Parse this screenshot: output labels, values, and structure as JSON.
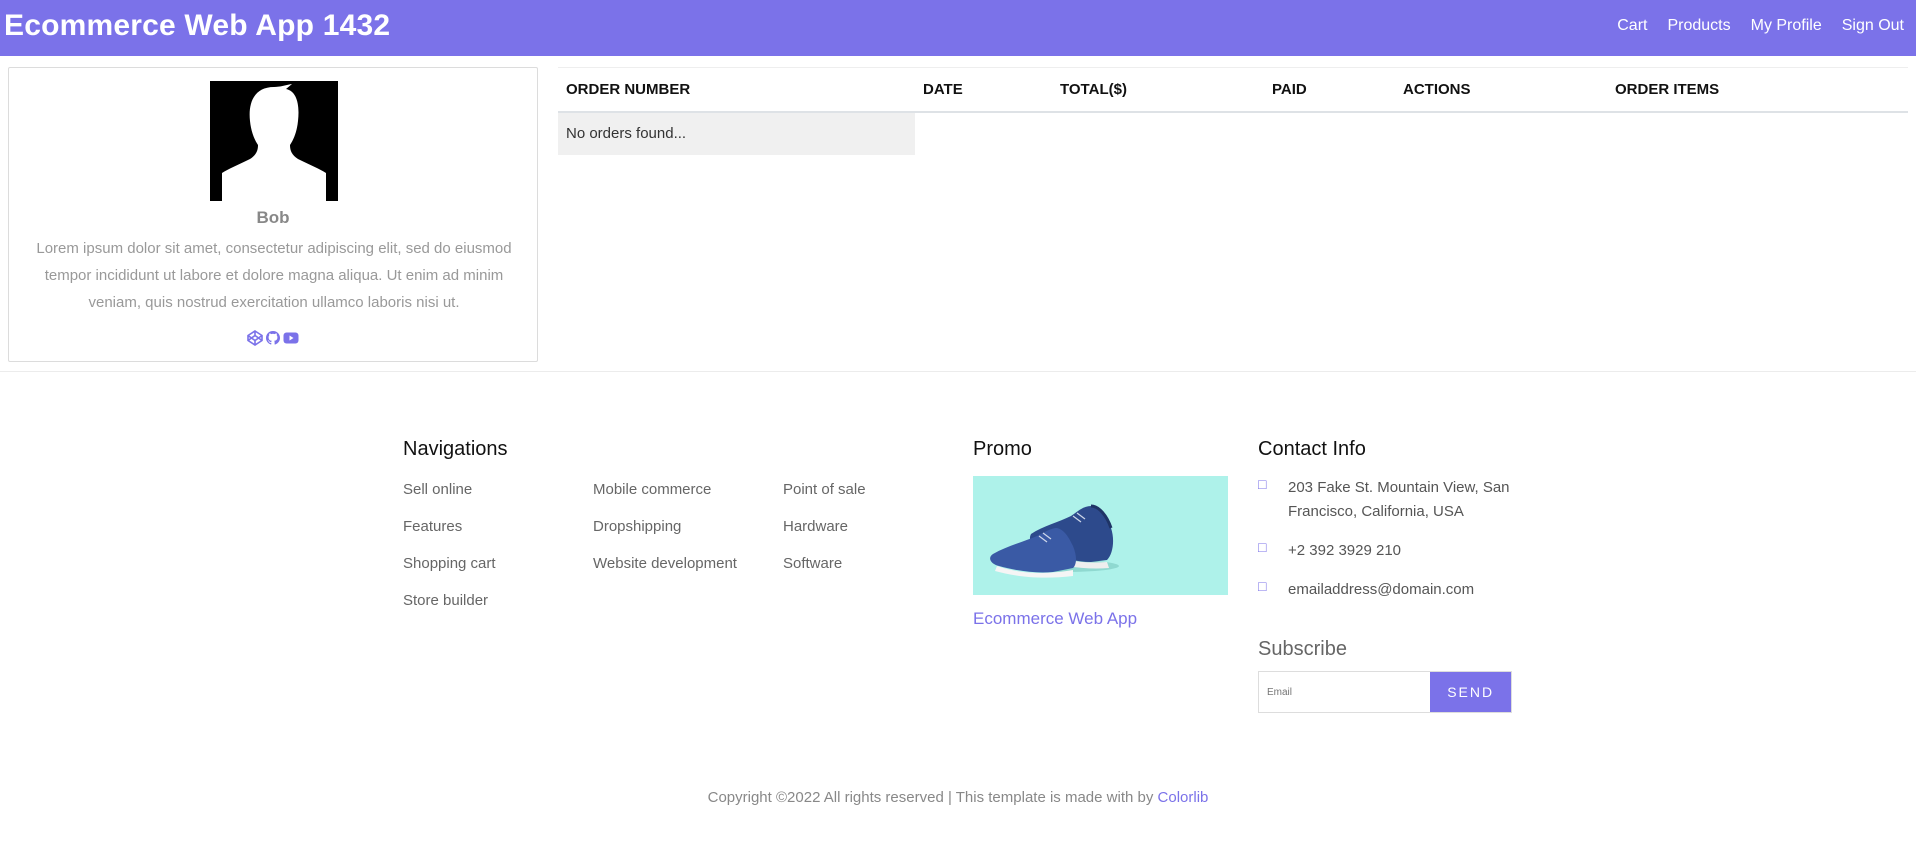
{
  "header": {
    "brand": "Ecommerce Web App 1432",
    "nav": [
      "Cart",
      "Products",
      "My Profile",
      "Sign Out"
    ]
  },
  "profile": {
    "name": "Bob",
    "bio": "Lorem ipsum dolor sit amet, consectetur adipiscing elit, sed do eiusmod tempor incididunt ut labore et dolore magna aliqua. Ut enim ad minim veniam, quis nostrud exercitation ullamco laboris nisi ut.",
    "socials": [
      "codepen-icon",
      "github-icon",
      "youtube-icon"
    ]
  },
  "orders": {
    "columns": [
      "ORDER NUMBER",
      "DATE",
      "TOTAL($)",
      "PAID",
      "ACTIONS",
      "ORDER ITEMS"
    ],
    "empty_message": "No orders found..."
  },
  "footer": {
    "navigations_title": "Navigations",
    "nav_columns": [
      [
        "Sell online",
        "Features",
        "Shopping cart",
        "Store builder"
      ],
      [
        "Mobile commerce",
        "Dropshipping",
        "Website development"
      ],
      [
        "Point of sale",
        "Hardware",
        "Software"
      ]
    ],
    "promo_title": "Promo",
    "promo_link": "Ecommerce Web App",
    "contact_title": "Contact Info",
    "contact": {
      "address": "203 Fake St. Mountain View, San Francisco, California, USA",
      "phone": "+2 392 3929 210",
      "email": "emailaddress@domain.com"
    },
    "subscribe_title": "Subscribe",
    "subscribe_placeholder": "Email",
    "subscribe_button": "SEND",
    "copyright": "Copyright ©2022 All rights reserved | This template is made with by",
    "copyright_link": "Colorlib"
  },
  "colors": {
    "accent": "#7b72e9",
    "promo_bg": "#aef2ea"
  }
}
